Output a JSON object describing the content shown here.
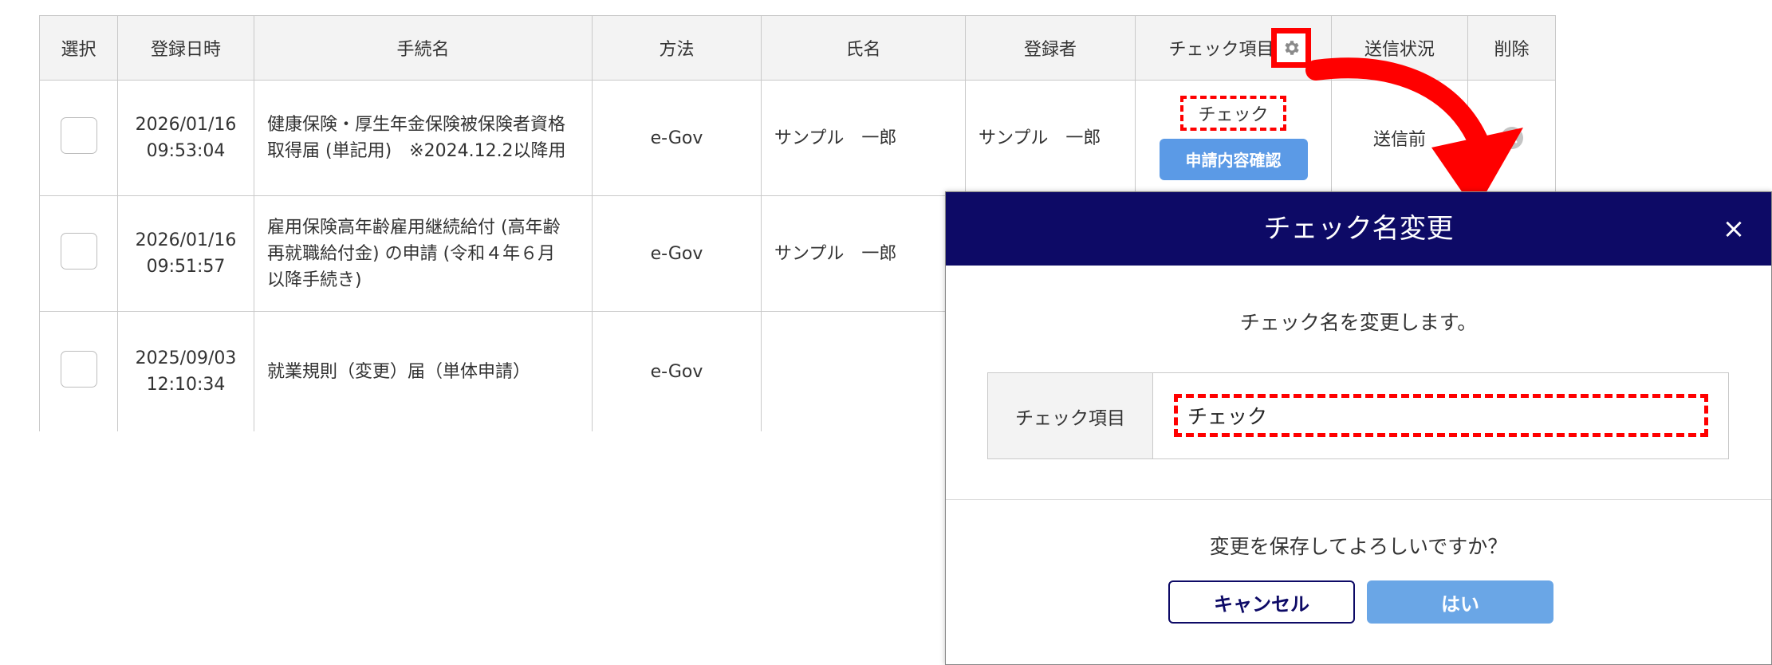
{
  "table": {
    "headers": {
      "select": "選択",
      "registered_at": "登録日時",
      "procedure": "手続名",
      "method": "方法",
      "name": "氏名",
      "registrant": "登録者",
      "check_item": "チェック項目",
      "send_status": "送信状況",
      "delete": "削除"
    },
    "rows": [
      {
        "date": "2026/01/16",
        "time": "09:53:04",
        "procedure_line1": "健康保険・厚生年金保険被保険者資格",
        "procedure_line2": "取得届 (単記用)　※2024.12.2以降用",
        "method": "e-Gov",
        "name": "サンプル　一郎",
        "registrant": "サンプル　一郎",
        "check_label": "チェック",
        "confirm_button": "申請内容確認",
        "send_status": "送信前"
      },
      {
        "date": "2026/01/16",
        "time": "09:51:57",
        "procedure_line1": "雇用保険高年齢雇用継続給付 (高年齢",
        "procedure_line2": "再就職給付金) の申請 (令和４年６月",
        "procedure_line3": "以降手続き)",
        "method": "e-Gov",
        "name": "サンプル　一郎"
      },
      {
        "date": "2025/09/03",
        "time": "12:10:34",
        "procedure_line1": "就業規則（変更）届（単体申請）",
        "method": "e-Gov"
      }
    ]
  },
  "modal": {
    "title": "チェック名変更",
    "close": "×",
    "message": "チェック名を変更します。",
    "field_label": "チェック項目",
    "field_value": "チェック",
    "confirm_question": "変更を保存してよろしいですか？",
    "cancel_button": "キャンセル",
    "yes_button": "はい"
  },
  "colors": {
    "modal_header": "#0d0a66",
    "highlight": "#ff0000",
    "primary_button": "#5b9ae6"
  },
  "icons": [
    "gear-icon",
    "delete-circle-icon",
    "close-icon",
    "red-arrow"
  ]
}
